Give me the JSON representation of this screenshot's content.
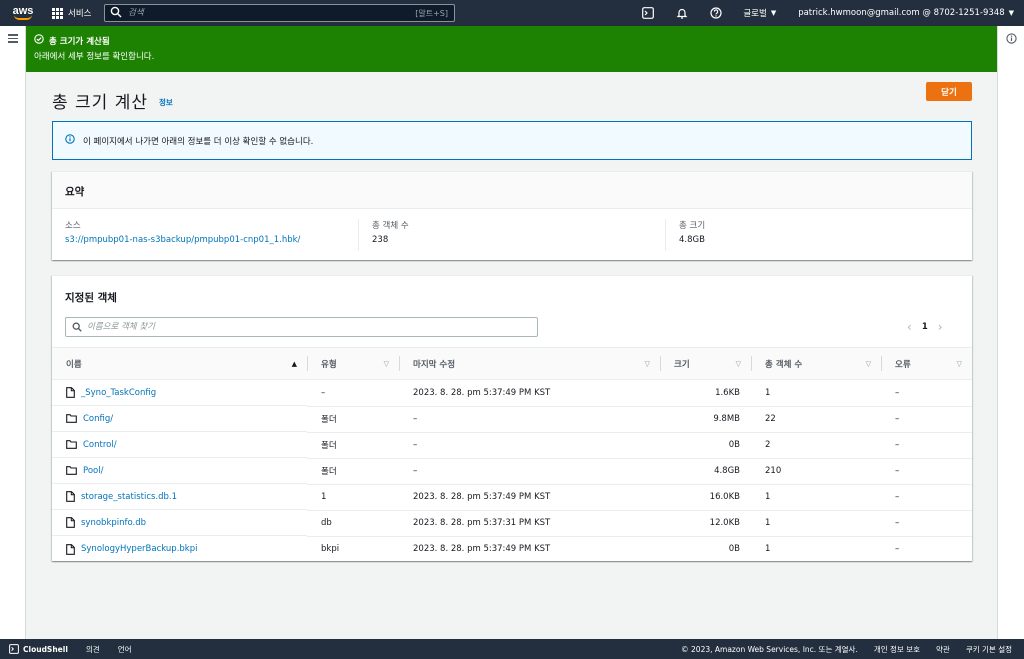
{
  "topnav": {
    "logo_text": "aws",
    "services_label": "서비스",
    "search_placeholder": "검색",
    "search_shortcut": "[알트+S]",
    "region_label": "글로벌",
    "account_label": "patrick.hwmoon@gmail.com @ 8702-1251-9348"
  },
  "flash": {
    "title": "총 크기가 계산됨",
    "message": "아래에서 세부 정보를 확인합니다."
  },
  "header": {
    "title": "총 크기 계산",
    "info_link": "정보",
    "close_button": "닫기"
  },
  "alert": {
    "text": "이 페이지에서 나가면 아래의 정보를 더 이상 확인할 수 없습니다."
  },
  "summary": {
    "title": "요약",
    "source_label": "소스",
    "source_value": "s3://pmpubp01-nas-s3backup/pmpubp01-cnp01_1.hbk/",
    "objects_label": "총 객체 수",
    "objects_value": "238",
    "size_label": "총 크기",
    "size_value": "4.8GB"
  },
  "objects": {
    "title": "지정된 객체",
    "search_placeholder": "이름으로 객체 찾기",
    "page": "1",
    "columns": {
      "name": "이름",
      "type": "유형",
      "modified": "마지막 수정",
      "size": "크기",
      "count": "총 객체 수",
      "error": "오류"
    },
    "rows": [
      {
        "icon": "file",
        "name": "_Syno_TaskConfig",
        "type": "–",
        "modified": "2023. 8. 28. pm 5:37:49 PM KST",
        "size": "1.6KB",
        "count": "1",
        "error": "–"
      },
      {
        "icon": "folder",
        "name": "Config/",
        "type": "폴더",
        "modified": "–",
        "size": "9.8MB",
        "count": "22",
        "error": "–"
      },
      {
        "icon": "folder",
        "name": "Control/",
        "type": "폴더",
        "modified": "–",
        "size": "0B",
        "count": "2",
        "error": "–"
      },
      {
        "icon": "folder",
        "name": "Pool/",
        "type": "폴더",
        "modified": "–",
        "size": "4.8GB",
        "count": "210",
        "error": "–"
      },
      {
        "icon": "file",
        "name": "storage_statistics.db.1",
        "type": "1",
        "modified": "2023. 8. 28. pm 5:37:49 PM KST",
        "size": "16.0KB",
        "count": "1",
        "error": "–"
      },
      {
        "icon": "file",
        "name": "synobkpinfo.db",
        "type": "db",
        "modified": "2023. 8. 28. pm 5:37:31 PM KST",
        "size": "12.0KB",
        "count": "1",
        "error": "–"
      },
      {
        "icon": "file",
        "name": "SynologyHyperBackup.bkpi",
        "type": "bkpi",
        "modified": "2023. 8. 28. pm 5:37:49 PM KST",
        "size": "0B",
        "count": "1",
        "error": "–"
      }
    ]
  },
  "footer": {
    "cloudshell": "CloudShell",
    "feedback": "의견",
    "language": "언어",
    "copyright": "© 2023, Amazon Web Services, Inc. 또는 계열사.",
    "privacy": "개인 정보 보호",
    "terms": "약관",
    "cookies": "쿠키 기본 설정"
  },
  "colors": {
    "nav_bg": "#232f3e",
    "success": "#1d8102",
    "primary": "#ec7211",
    "link": "#0073bb"
  }
}
